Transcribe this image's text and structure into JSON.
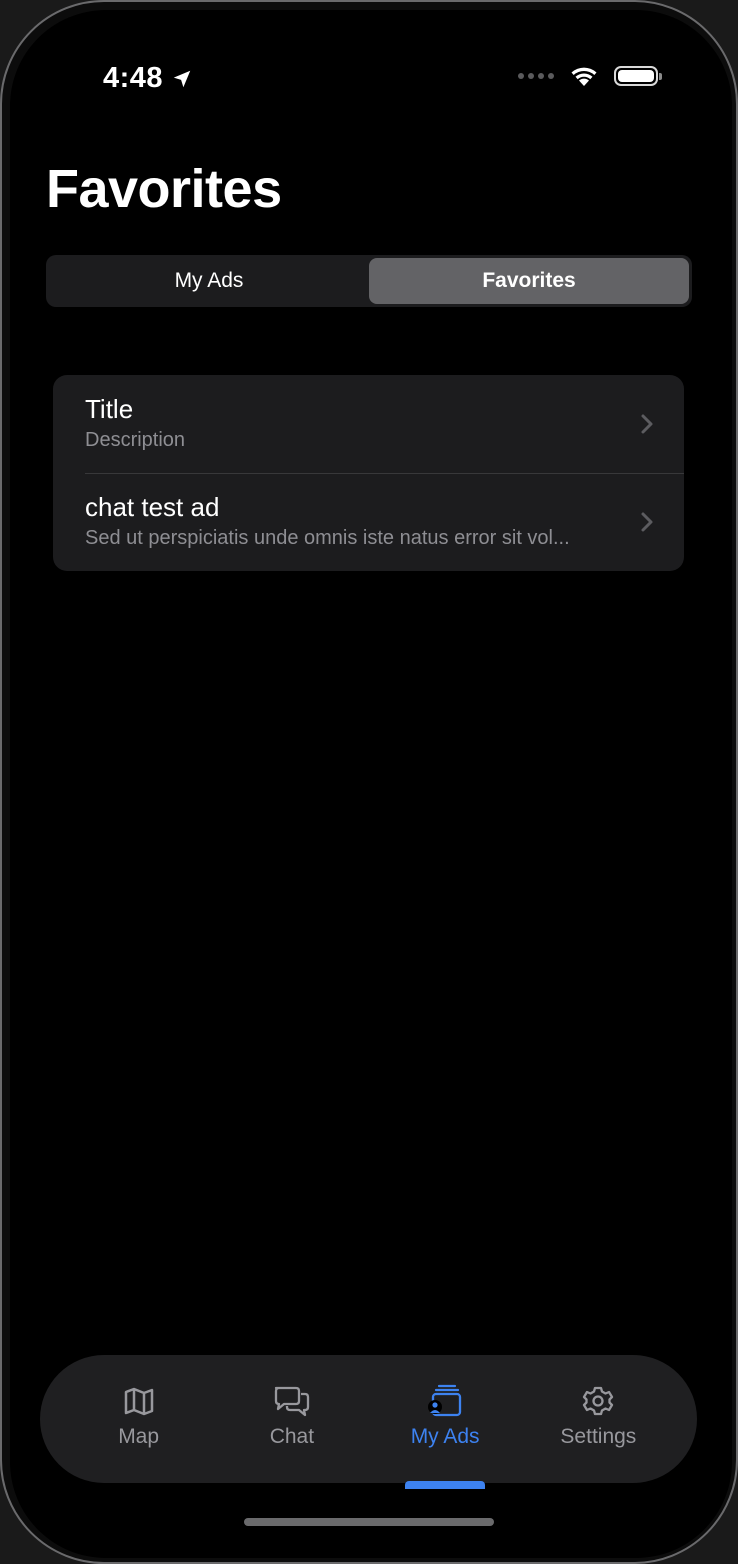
{
  "status_bar": {
    "time": "4:48",
    "location_icon": "location-arrow-icon",
    "wifi_icon": "wifi-icon",
    "battery_icon": "battery-icon"
  },
  "header": {
    "title": "Favorites"
  },
  "segmented_control": {
    "segments": [
      {
        "label": "My Ads",
        "selected": false
      },
      {
        "label": "Favorites",
        "selected": true
      }
    ]
  },
  "list": {
    "items": [
      {
        "title": "Title",
        "description": "Description"
      },
      {
        "title": "chat test ad",
        "description": "Sed ut perspiciatis unde omnis iste natus error sit vol..."
      }
    ]
  },
  "tab_bar": {
    "items": [
      {
        "label": "Map",
        "icon": "map-icon",
        "active": false
      },
      {
        "label": "Chat",
        "icon": "chat-bubbles-icon",
        "active": false
      },
      {
        "label": "My Ads",
        "icon": "my-ads-icon",
        "active": true
      },
      {
        "label": "Settings",
        "icon": "gear-icon",
        "active": false
      }
    ]
  },
  "colors": {
    "accent": "#3d82f0",
    "background": "#000000",
    "card": "#1c1c1e",
    "secondary_text": "#8e8e93"
  }
}
